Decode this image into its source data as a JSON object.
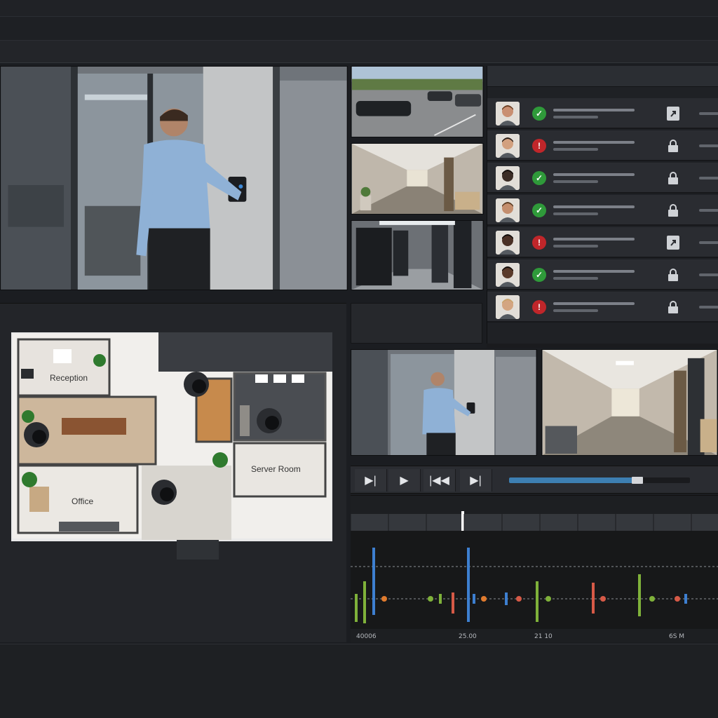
{
  "floorplan": {
    "rooms": {
      "reception": "Reception",
      "office": "Office",
      "server_room": "Server Room"
    }
  },
  "access_log": [
    {
      "status": "granted",
      "lock": "door-open"
    },
    {
      "status": "denied",
      "lock": "locked"
    },
    {
      "status": "granted",
      "lock": "locked"
    },
    {
      "status": "granted",
      "lock": "locked"
    },
    {
      "status": "denied",
      "lock": "door-open"
    },
    {
      "status": "granted",
      "lock": "locked"
    },
    {
      "status": "denied",
      "lock": "locked"
    }
  ],
  "playback": {
    "progress": 0.7,
    "icons": [
      "skip-back-icon",
      "play-icon",
      "rewind-icon",
      "skip-forward-icon"
    ]
  },
  "timeline": {
    "tick_labels": [
      "40006",
      "25.00",
      "21 10",
      "6S M"
    ]
  },
  "colors": {
    "granted": "#2f9a3a",
    "denied": "#c0262a",
    "accent": "#3d7fb2",
    "event_blue": "#3d7fd0",
    "event_green": "#7fb13a",
    "event_red": "#d65a47",
    "event_orange": "#e07b2e"
  }
}
